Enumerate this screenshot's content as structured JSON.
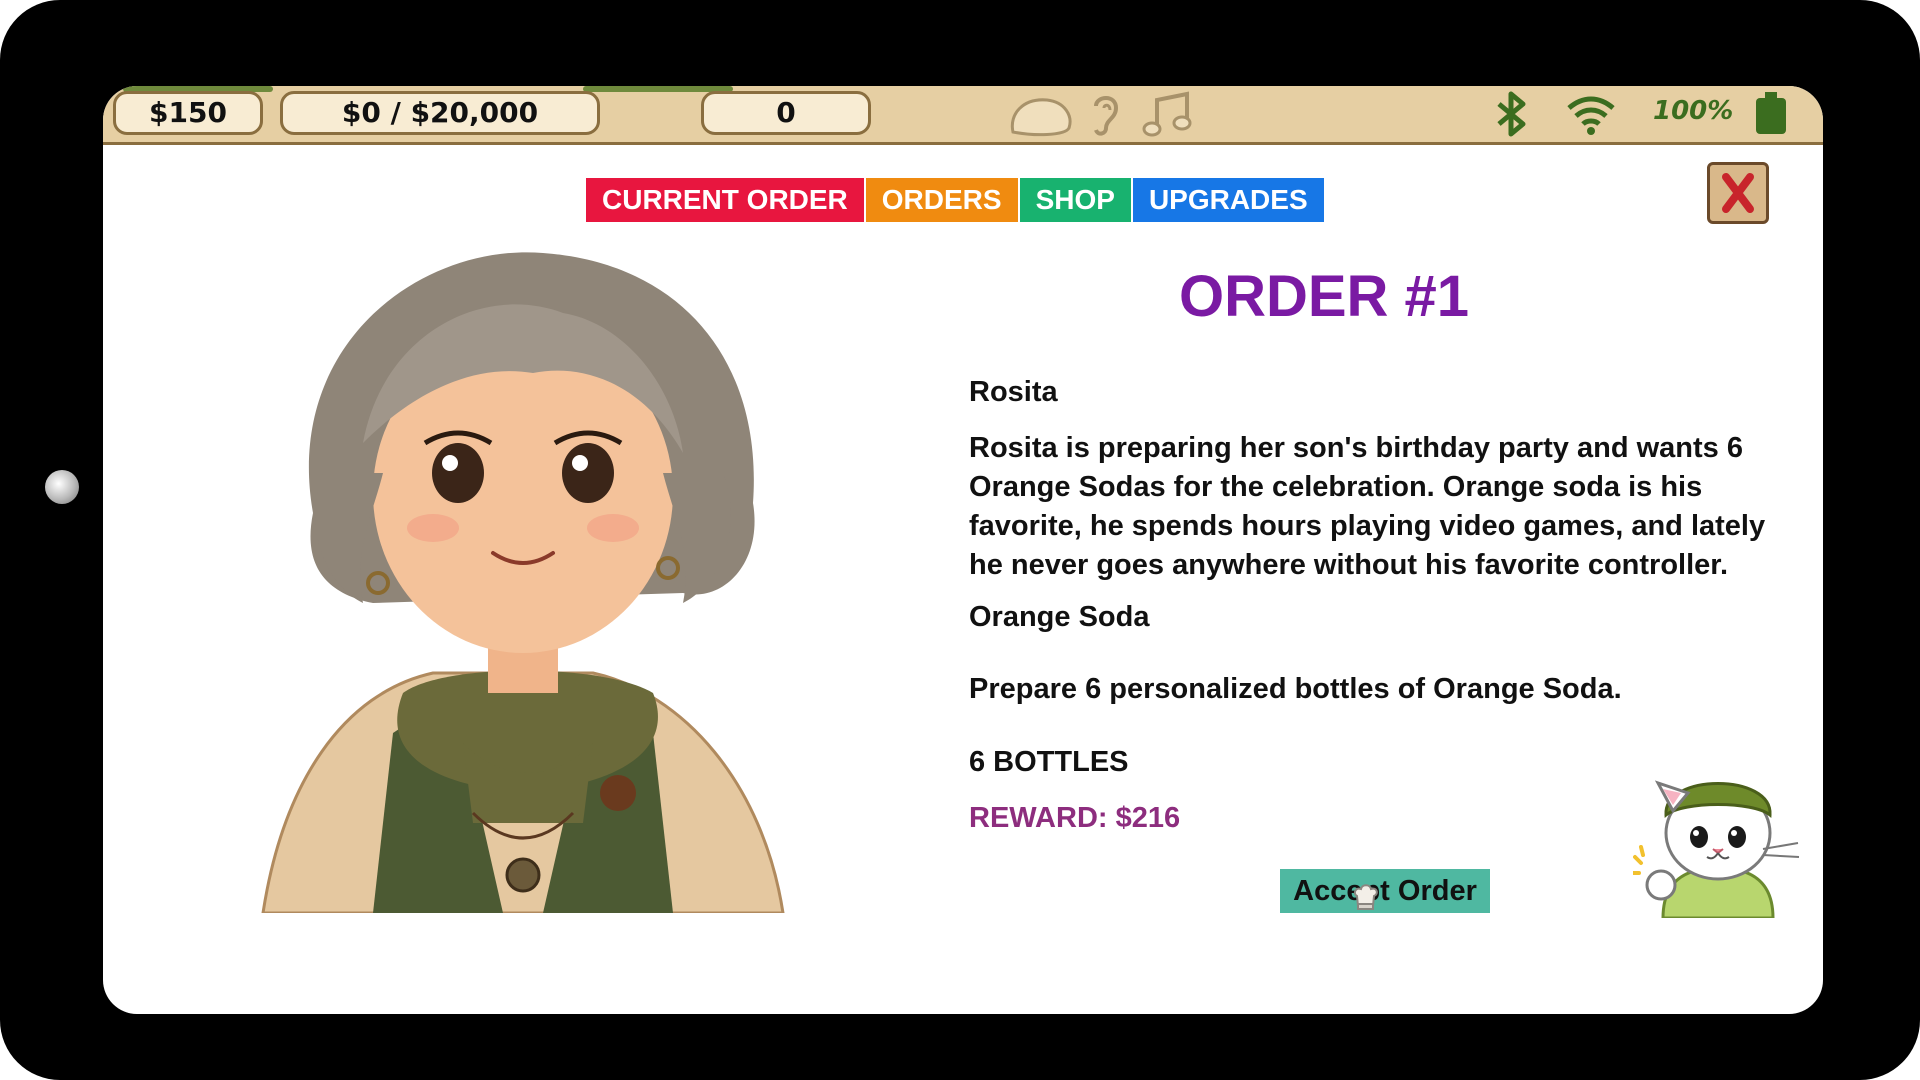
{
  "statusbar": {
    "money": "$150",
    "goal": "$0 / $20,000",
    "count": "0",
    "icons": [
      "chat-bubble-icon",
      "ear-icon",
      "music-note-icon",
      "bluetooth-icon",
      "wifi-icon",
      "battery-icon"
    ],
    "battery": "100%"
  },
  "tabs": [
    {
      "label": "CURRENT ORDER",
      "color": "#e8163f"
    },
    {
      "label": "ORDERS",
      "color": "#f08b10"
    },
    {
      "label": "SHOP",
      "color": "#18b26f"
    },
    {
      "label": "UPGRADES",
      "color": "#1777e6"
    }
  ],
  "order": {
    "title": "ORDER #1",
    "customer": "Rosita",
    "description": "Rosita is preparing her son's birthday party and wants 6 Orange Sodas for the celebration. Orange soda is his favorite, he spends hours playing video games, and lately he never goes anywhere without his favorite controller.",
    "product": "Orange Soda",
    "task": "Prepare 6 personalized bottles of Orange Soda.",
    "quantity": "6 BOTTLES",
    "reward": "REWARD: $216",
    "accept_label": "Accept Order"
  },
  "colors": {
    "accent_title": "#7a1aa3",
    "reward": "#8d2d7e",
    "accept_button": "#4fb8a1",
    "statusbar": "#e6cfa3"
  }
}
